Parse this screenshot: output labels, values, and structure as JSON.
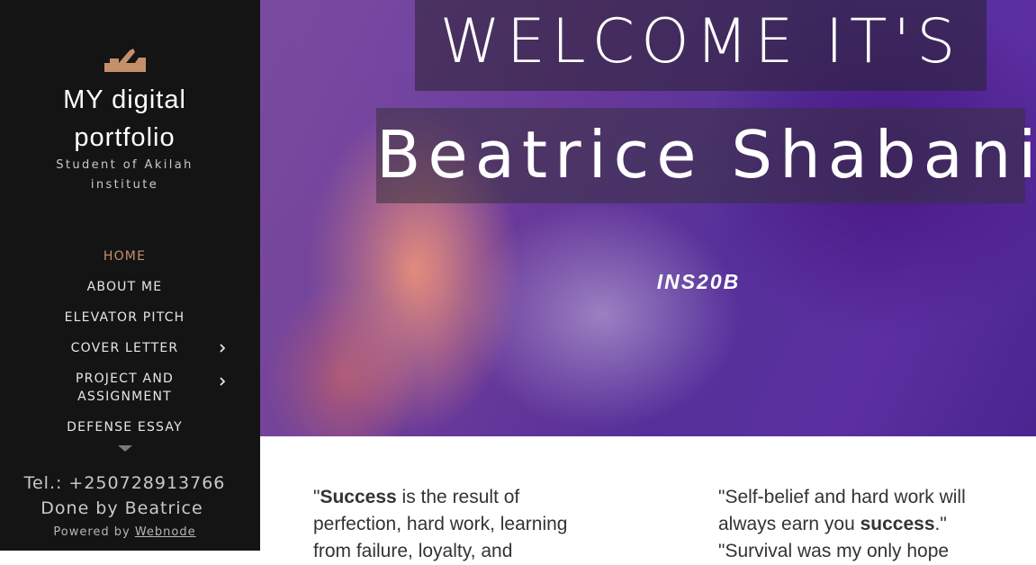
{
  "sidebar": {
    "logo_icon": "hand-plane-icon",
    "title_line1": "MY digital",
    "title_line2": "portfolio",
    "subtitle_line1": "Student of Akilah",
    "subtitle_line2": "institute",
    "nav": [
      {
        "label": "HOME",
        "active": true
      },
      {
        "label": "ABOUT ME"
      },
      {
        "label": "ELEVATOR PITCH"
      },
      {
        "label": "COVER LETTER",
        "has_submenu": true
      },
      {
        "label": "PROJECT AND ASSIGNMENT",
        "has_submenu": true
      },
      {
        "label": "DEFENSE ESSAY"
      }
    ],
    "tel": "Tel.:   +250728913766",
    "done_by": "Done by Beatrice",
    "powered_prefix": "Powered by ",
    "powered_link": "Webnode"
  },
  "hero": {
    "headline1": "WELCOME IT'S",
    "headline2": "Beatrice Shabani",
    "code": "INS20B"
  },
  "quotes": {
    "left": {
      "open": "\"",
      "bold": "Success",
      "rest": " is the result of perfection, hard work, learning from failure, loyalty, and"
    },
    "right": {
      "line1_pre": "\"Self-belief and hard work will always earn you ",
      "line1_bold": "success",
      "line1_post": ".\"",
      "line2": "\"Survival was my only hope"
    }
  },
  "colors": {
    "sidebar_bg": "#141414",
    "accent": "#c4906b",
    "body_text": "#333333"
  }
}
